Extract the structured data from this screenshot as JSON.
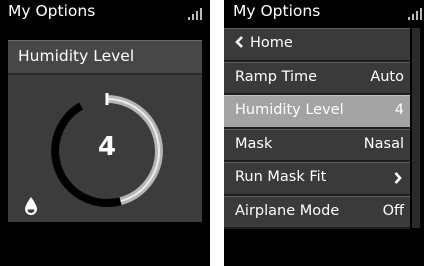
{
  "left_screen": {
    "status_bar": {
      "title": "My Options",
      "signal_icon": "signal-bars-icon"
    },
    "humidity_panel": {
      "title": "Humidity Level",
      "value": "4",
      "level_fraction": 0.5,
      "icon": "water-drop-icon"
    }
  },
  "right_screen": {
    "status_bar": {
      "title": "My Options",
      "signal_icon": "signal-bars-icon"
    },
    "menu": {
      "home": {
        "icon": "chevron-left-icon",
        "label": "Home"
      },
      "items": [
        {
          "label": "Ramp Time",
          "value": "Auto"
        },
        {
          "label": "Humidity Level",
          "value": "4",
          "selected": true
        },
        {
          "label": "Mask",
          "value": "Nasal"
        },
        {
          "label": "Run Mask Fit",
          "icon": "chevron-right-icon"
        },
        {
          "label": "Airplane Mode",
          "value": "Off"
        }
      ]
    }
  },
  "colors": {
    "screen_background": "#000000",
    "panel_background": "#3c3c3c",
    "selected_row": "#a3a3a3",
    "dial_track": "#b5b5b5",
    "dial_fill": "#000000",
    "text": "#ffffff"
  }
}
